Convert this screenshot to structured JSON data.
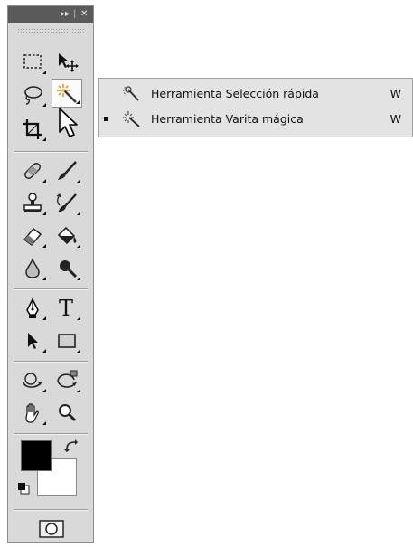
{
  "panel": {
    "titlebar": {
      "expand_glyph": "▸▸",
      "close_glyph": "✕"
    }
  },
  "flyout": {
    "items": [
      {
        "label": "Herramienta Selección rápida",
        "shortcut": "W",
        "selected": false,
        "icon": "quick-selection-icon"
      },
      {
        "label": "Herramienta Varita mágica",
        "shortcut": "W",
        "selected": true,
        "icon": "magic-wand-icon"
      }
    ]
  },
  "tools": [
    "marquee-icon",
    "move-icon",
    "lasso-icon",
    "magic-wand-icon",
    "crop-icon",
    "cursor-arrow-icon",
    "healing-brush-icon",
    "brush-icon",
    "clone-stamp-icon",
    "history-brush-icon",
    "eraser-icon",
    "paint-bucket-icon",
    "blur-icon",
    "dodge-icon",
    "pen-icon",
    "type-icon",
    "path-selection-icon",
    "rectangle-shape-icon",
    "rotate-3d-icon",
    "orbit-3d-icon",
    "hand-icon",
    "zoom-icon"
  ],
  "colors": {
    "foreground": "#000000",
    "background": "#ffffff",
    "panel": "#d9d9d9",
    "titlebar": "#5a5a5a"
  },
  "text_tool": {
    "glyph": "T"
  }
}
